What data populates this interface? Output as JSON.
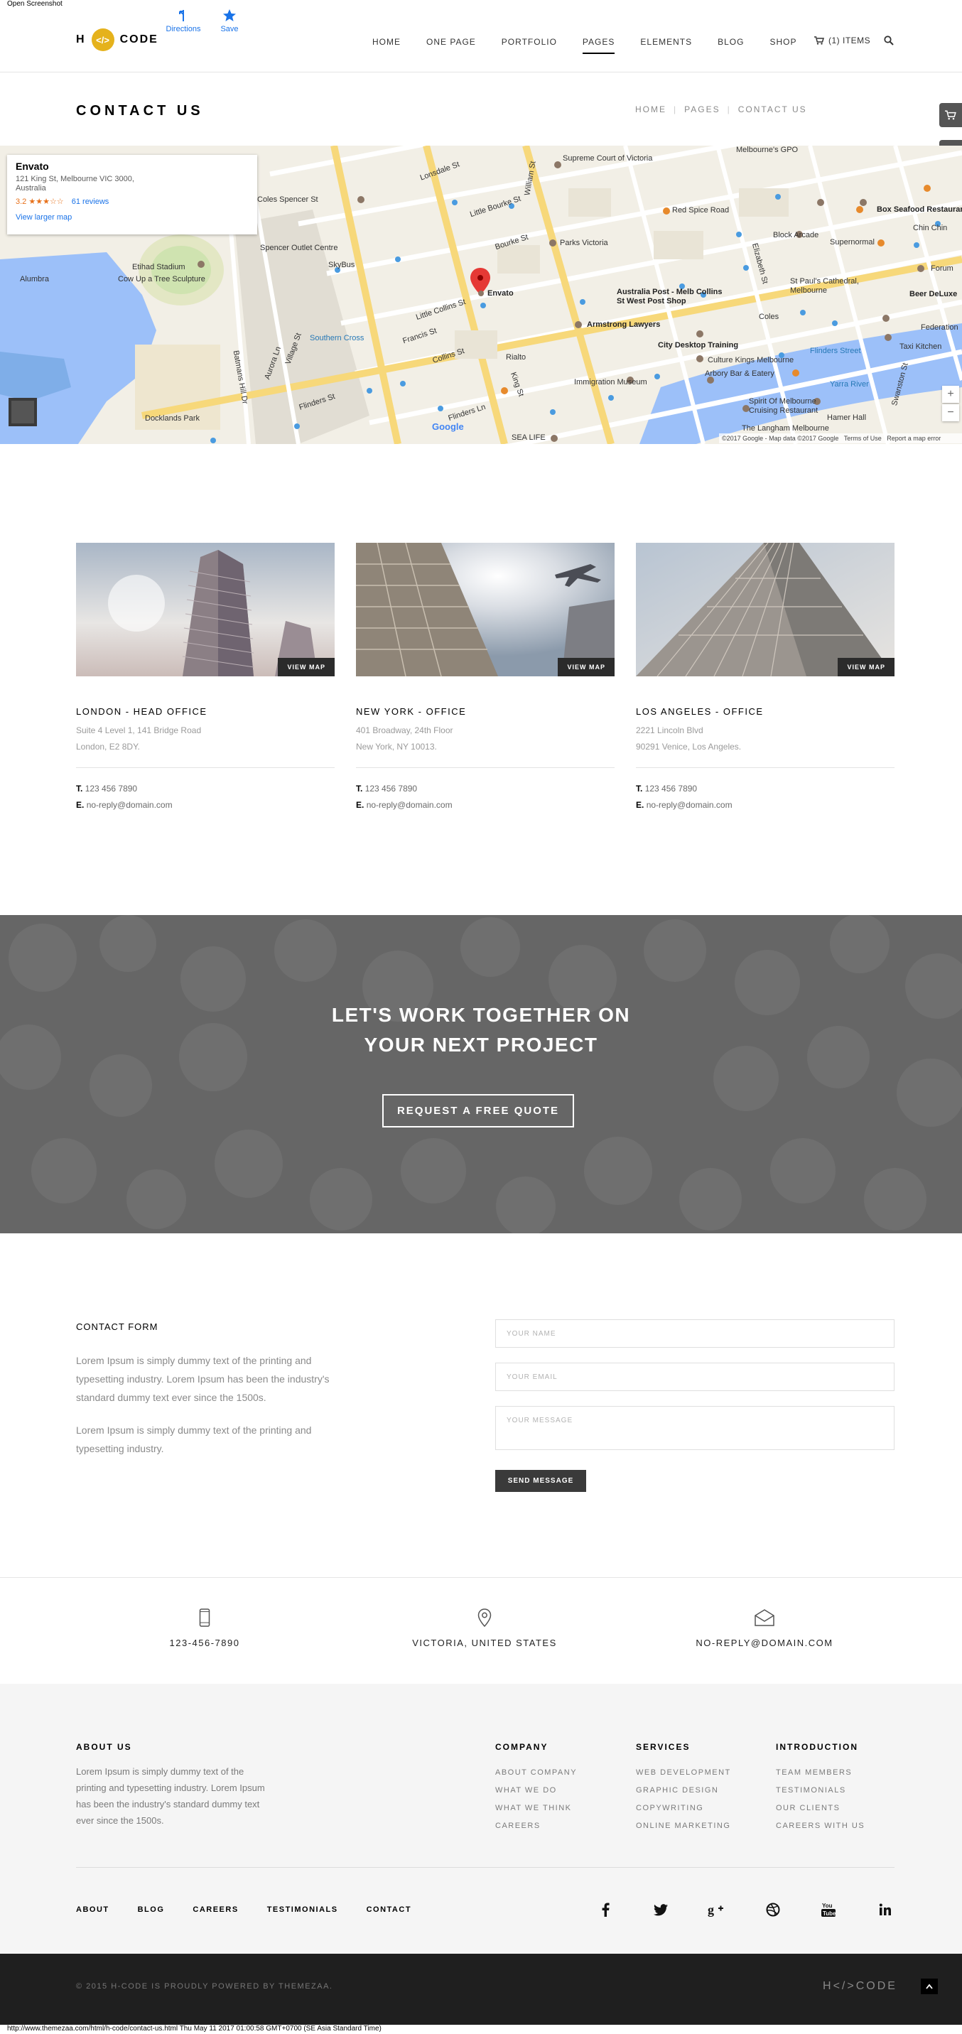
{
  "capture": {
    "label": "Open Screenshot",
    "footer": "http://www.themezaa.com/html/h-code/contact-us.html Thu May 11 2017 01:00:58 GMT+0700 (SE Asia Standard Time)"
  },
  "header": {
    "logo_left": "H",
    "logo_mark": "</>",
    "logo_right": "CODE",
    "nav": [
      "HOME",
      "ONE PAGE",
      "PORTFOLIO",
      "PAGES",
      "ELEMENTS",
      "BLOG",
      "SHOP"
    ],
    "active_nav": "PAGES",
    "cart_label": "(1) ITEMS"
  },
  "title_band": {
    "title": "CONTACT US",
    "breadcrumbs": [
      "HOME",
      "PAGES",
      "CONTACT US"
    ]
  },
  "map": {
    "card": {
      "title": "Envato",
      "address": "121 King St, Melbourne VIC 3000, Australia",
      "rating": "3.2",
      "stars": "★★★☆☆",
      "reviews": "61 reviews",
      "larger_map": "View larger map",
      "directions": "Directions",
      "save": "Save"
    },
    "marker_label": "Envato",
    "places": [
      "Supreme Court of Victoria",
      "Coles Spencer St",
      "Spencer Outlet Centre",
      "SkyBus",
      "Etihad Stadium",
      "Cow Up a Tree Sculpture",
      "Alumbra",
      "Southern Cross",
      "Docklands Park",
      "Parks Victoria",
      "Red Spice Road",
      "Block Arcade",
      "Supernormal",
      "Box Seafood Restaurant",
      "Chin Chin",
      "St Paul's Cathedral, Melbourne",
      "Australia Post - Melb Collins St West Post Shop",
      "Armstrong Lawyers",
      "City Desktop Training",
      "Culture Kings Melbourne",
      "Arbory Bar & Eatery",
      "Immigration Museum",
      "Rialto",
      "Spirit Of Melbourne Cruising Restaurant",
      "The Langham Melbourne",
      "Hamer Hall",
      "Flinders Street",
      "Taxi Kitchen",
      "Federation",
      "Beer DeLuxe",
      "Forum",
      "Yarra River",
      "Melbourne's GPO",
      "SEA LIFE",
      "Coles"
    ],
    "streets": [
      "Lonsdale St",
      "Little Bourke St",
      "Bourke St",
      "Little Collins St",
      "Collins St",
      "Flinders Ln",
      "Flinders St",
      "Francis St",
      "King St",
      "William St",
      "Elizabeth St",
      "Swanston St",
      "Aurora Ln",
      "Village St",
      "Batmans Hill Dr",
      "Docklands Park"
    ],
    "attribution": "©2017 Google - Map data ©2017 Google",
    "terms": "Terms of Use",
    "report": "Report a map error",
    "google": "Google",
    "zoom_in": "+",
    "zoom_out": "−"
  },
  "offices": [
    {
      "name": "LONDON - HEAD OFFICE",
      "address1": "Suite 4 Level 1, 141 Bridge Road",
      "address2": "London, E2 8DY.",
      "phone_label": "T.",
      "phone": "123 456 7890",
      "email_label": "E.",
      "email": "no-reply@domain.com",
      "button": "VIEW MAP"
    },
    {
      "name": "NEW YORK - OFFICE",
      "address1": "401 Broadway, 24th Floor",
      "address2": "New York, NY 10013.",
      "phone_label": "T.",
      "phone": "123 456 7890",
      "email_label": "E.",
      "email": "no-reply@domain.com",
      "button": "VIEW MAP"
    },
    {
      "name": "LOS ANGELES - OFFICE",
      "address1": "2221 Lincoln Blvd",
      "address2": "90291 Venice, Los Angeles.",
      "phone_label": "T.",
      "phone": "123 456 7890",
      "email_label": "E.",
      "email": "no-reply@domain.com",
      "button": "VIEW MAP"
    }
  ],
  "cta": {
    "line1": "LET'S WORK TOGETHER ON",
    "line2": "YOUR NEXT PROJECT",
    "button": "REQUEST A FREE QUOTE"
  },
  "contact_form": {
    "heading": "CONTACT FORM",
    "para1": "Lorem Ipsum is simply dummy text of the printing and typesetting industry. Lorem Ipsum has been the industry's standard dummy text ever since the 1500s.",
    "para2": "Lorem Ipsum is simply dummy text of the printing and typesetting industry.",
    "name_placeholder": "YOUR NAME",
    "email_placeholder": "YOUR EMAIL",
    "message_placeholder": "YOUR MESSAGE",
    "send": "SEND MESSAGE"
  },
  "contact_strip": {
    "phone": "123-456-7890",
    "location": "VICTORIA, UNITED STATES",
    "email": "NO-REPLY@DOMAIN.COM"
  },
  "footer": {
    "about_heading": "ABOUT US",
    "about_text": "Lorem Ipsum is simply dummy text of the printing and typesetting industry. Lorem Ipsum has been the industry's standard dummy text ever since the 1500s.",
    "columns": [
      {
        "heading": "COMPANY",
        "items": [
          "ABOUT COMPANY",
          "WHAT WE DO",
          "WHAT WE THINK",
          "CAREERS"
        ]
      },
      {
        "heading": "SERVICES",
        "items": [
          "WEB DEVELOPMENT",
          "GRAPHIC DESIGN",
          "COPYWRITING",
          "ONLINE MARKETING"
        ]
      },
      {
        "heading": "INTRODUCTION",
        "items": [
          "TEAM MEMBERS",
          "TESTIMONIALS",
          "OUR CLIENTS",
          "CAREERS WITH US"
        ]
      }
    ],
    "bottom_links": [
      "ABOUT",
      "BLOG",
      "CAREERS",
      "TESTIMONIALS",
      "CONTACT"
    ],
    "social": [
      "facebook-icon",
      "twitter-icon",
      "google-plus-icon",
      "dribbble-icon",
      "youtube-icon",
      "linkedin-icon"
    ],
    "copyright": "© 2015 H-CODE IS PROUDLY POWERED BY THEMEZAA.",
    "logo_left": "H",
    "logo_mark": "</>",
    "logo_right": "CODE",
    "accent": "#e5b21c"
  }
}
